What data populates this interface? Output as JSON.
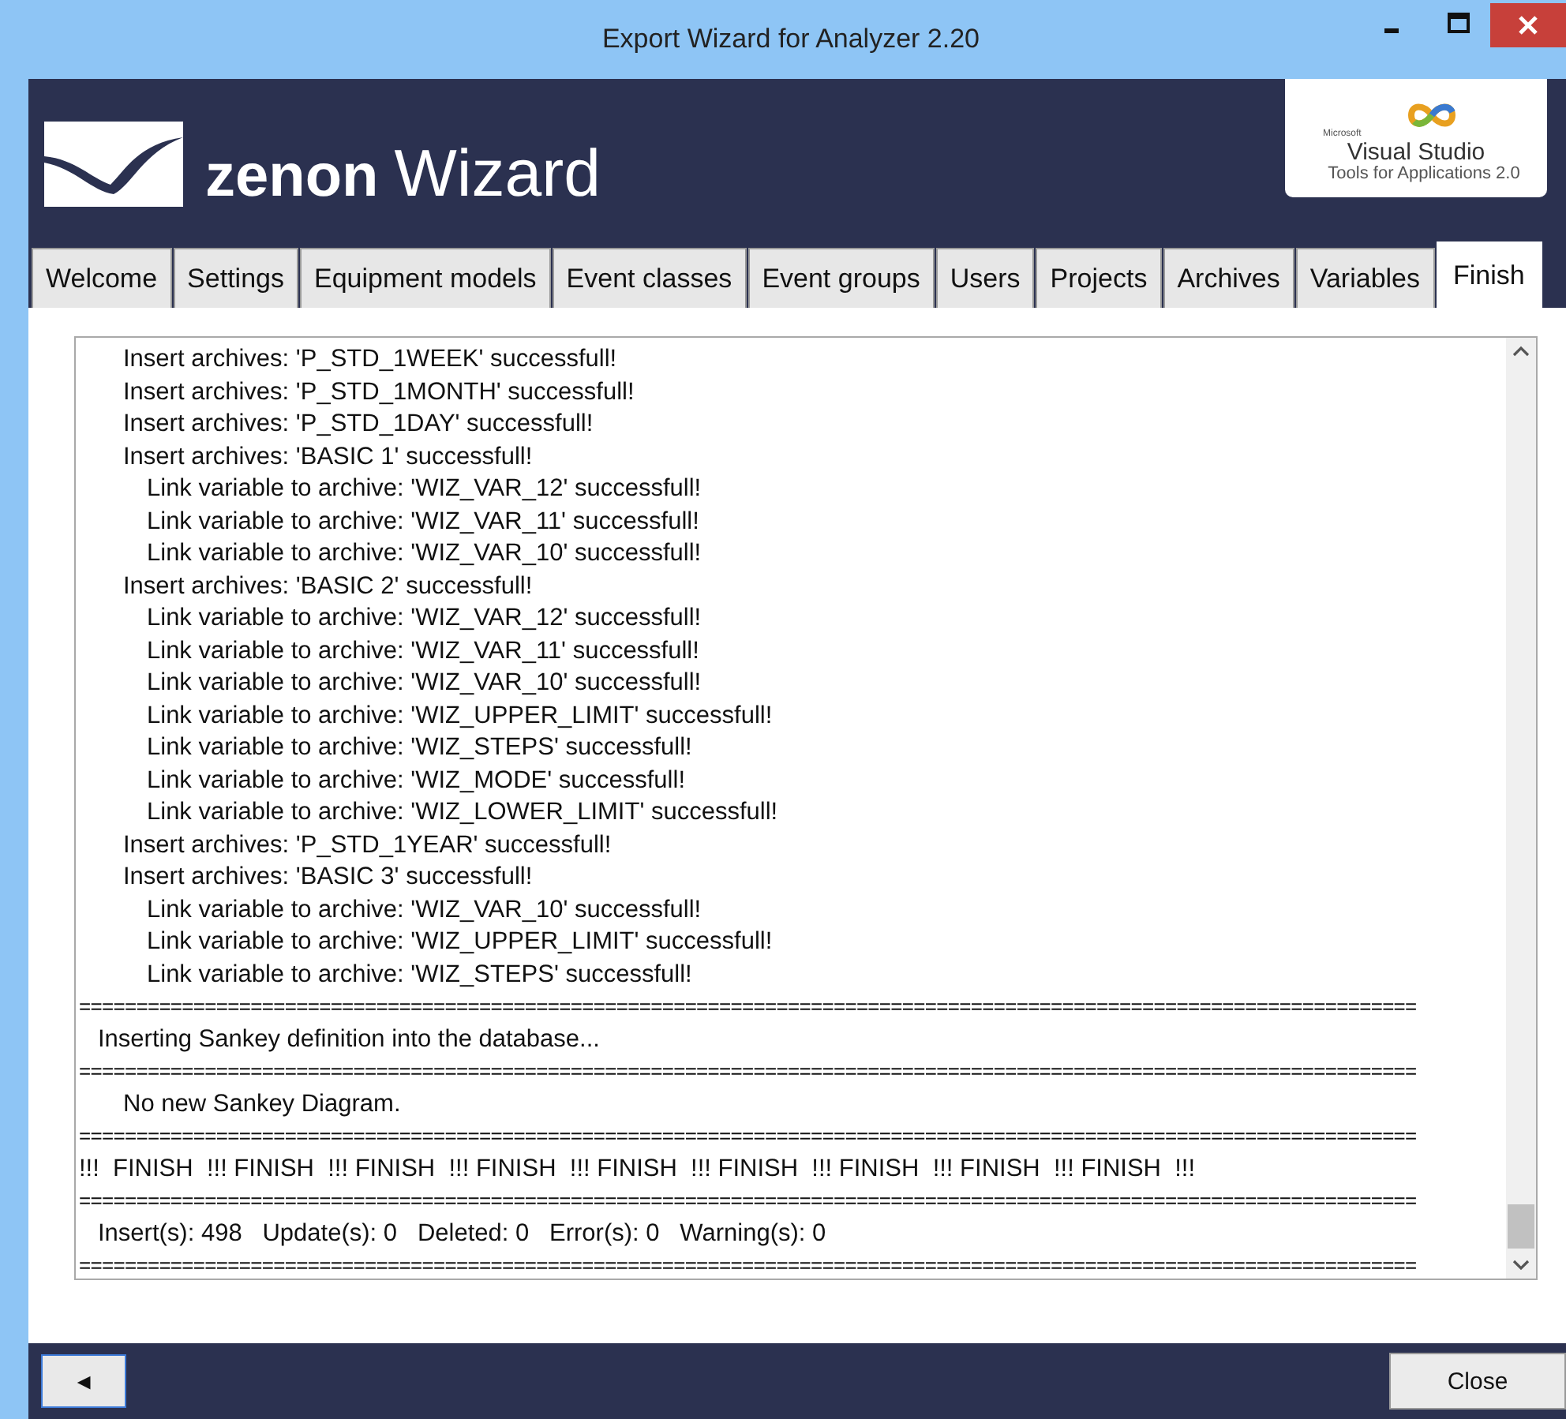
{
  "window": {
    "title": "Export Wizard for Analyzer 2.20"
  },
  "header": {
    "logo_word1": "zenon",
    "logo_word2": "Wizard",
    "badge": {
      "small": "Microsoft",
      "product": "Visual Studio",
      "subtitle": "Tools for Applications 2.0"
    }
  },
  "tabs": [
    {
      "label": "Welcome",
      "selected": false
    },
    {
      "label": "Settings",
      "selected": false
    },
    {
      "label": "Equipment models",
      "selected": false
    },
    {
      "label": "Event classes",
      "selected": false
    },
    {
      "label": "Event groups",
      "selected": false
    },
    {
      "label": "Users",
      "selected": false
    },
    {
      "label": "Projects",
      "selected": false
    },
    {
      "label": "Archives",
      "selected": false
    },
    {
      "label": "Variables",
      "selected": false
    },
    {
      "label": "Finish",
      "selected": true
    }
  ],
  "log": [
    {
      "kind": "line",
      "text": "Insert archives: 'P_STD_1WEEK' successfull!"
    },
    {
      "kind": "line",
      "text": "Insert archives: 'P_STD_1MONTH' successfull!"
    },
    {
      "kind": "line",
      "text": "Insert archives: 'P_STD_1DAY' successfull!"
    },
    {
      "kind": "line",
      "text": "Insert archives: 'BASIC 1' successfull!",
      "children": [
        {
          "kind": "line",
          "text": "Link variable to archive: 'WIZ_VAR_12' successfull!"
        },
        {
          "kind": "line",
          "text": "Link variable to archive: 'WIZ_VAR_11' successfull!"
        },
        {
          "kind": "line",
          "text": "Link variable to archive: 'WIZ_VAR_10' successfull!"
        }
      ]
    },
    {
      "kind": "line",
      "text": "Insert archives: 'BASIC 2' successfull!",
      "children": [
        {
          "kind": "line",
          "text": "Link variable to archive: 'WIZ_VAR_12' successfull!"
        },
        {
          "kind": "line",
          "text": "Link variable to archive: 'WIZ_VAR_11' successfull!"
        },
        {
          "kind": "line",
          "text": "Link variable to archive: 'WIZ_VAR_10' successfull!"
        },
        {
          "kind": "line",
          "text": "Link variable to archive: 'WIZ_UPPER_LIMIT' successfull!"
        },
        {
          "kind": "line",
          "text": "Link variable to archive: 'WIZ_STEPS' successfull!"
        },
        {
          "kind": "line",
          "text": "Link variable to archive: 'WIZ_MODE' successfull!"
        },
        {
          "kind": "line",
          "text": "Link variable to archive: 'WIZ_LOWER_LIMIT' successfull!"
        }
      ]
    },
    {
      "kind": "line",
      "text": "Insert archives: 'P_STD_1YEAR' successfull!"
    },
    {
      "kind": "line",
      "text": "Insert archives: 'BASIC 3' successfull!",
      "children": [
        {
          "kind": "line",
          "text": "Link variable to archive: 'WIZ_VAR_10' successfull!"
        },
        {
          "kind": "line",
          "text": "Link variable to archive: 'WIZ_UPPER_LIMIT' successfull!"
        },
        {
          "kind": "line",
          "text": "Link variable to archive: 'WIZ_STEPS' successfull!"
        }
      ]
    },
    {
      "kind": "separator",
      "text": "====================================================================================================================="
    },
    {
      "kind": "message",
      "text": "Inserting Sankey definition into the database..."
    },
    {
      "kind": "separator",
      "text": "====================================================================================================================="
    },
    {
      "kind": "line",
      "text": "No new Sankey Diagram."
    },
    {
      "kind": "separator",
      "text": "====================================================================================================================="
    },
    {
      "kind": "banner",
      "text": "!!!  FINISH  !!! FINISH  !!! FINISH  !!! FINISH  !!! FINISH  !!! FINISH  !!! FINISH  !!! FINISH  !!! FINISH  !!!"
    },
    {
      "kind": "separator",
      "text": "====================================================================================================================="
    },
    {
      "kind": "message",
      "text": "Insert(s): 498   Update(s): 0   Deleted: 0   Error(s): 0   Warning(s): 0"
    },
    {
      "kind": "separator",
      "text": "====================================================================================================================="
    }
  ],
  "footer": {
    "back": "◄",
    "close": "Close"
  }
}
